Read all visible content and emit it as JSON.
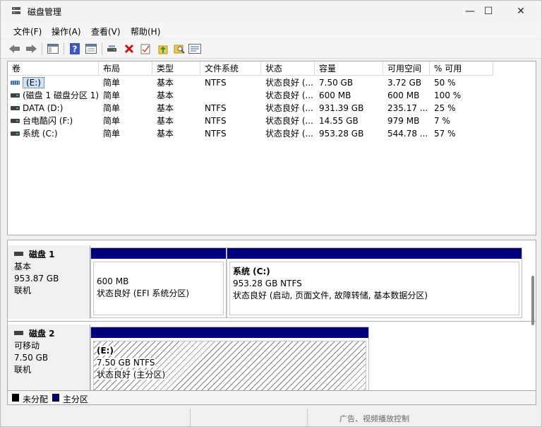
{
  "window": {
    "title": "磁盘管理",
    "minimize": "—",
    "maximize": "☐",
    "close": "✕"
  },
  "menu": [
    "文件(F)",
    "操作(A)",
    "查看(V)",
    "帮助(H)"
  ],
  "toolbar": {
    "icons": [
      "back-arrow-icon",
      "forward-arrow-icon",
      "console-tree-icon",
      "help-icon",
      "properties-list-icon",
      "connect-drive-icon",
      "delete-icon",
      "check-icon",
      "upload-folder-icon",
      "search-folder-icon",
      "settings-list-icon"
    ]
  },
  "volumes": {
    "headers": [
      "卷",
      "布局",
      "类型",
      "文件系统",
      "状态",
      "容量",
      "可用空间",
      "% 可用"
    ],
    "rows": [
      {
        "volume": "(E:)",
        "layout": "简单",
        "type": "基本",
        "fs": "NTFS",
        "status": "状态良好 (...",
        "capacity": "7.50 GB",
        "free": "3.72 GB",
        "pct": "50 %",
        "selected": true,
        "icon": "usb-drive-icon"
      },
      {
        "volume": "(磁盘 1 磁盘分区 1)",
        "layout": "简单",
        "type": "基本",
        "fs": "",
        "status": "状态良好 (...",
        "capacity": "600 MB",
        "free": "600 MB",
        "pct": "100 %",
        "selected": false,
        "icon": "drive-icon"
      },
      {
        "volume": "DATA (D:)",
        "layout": "简单",
        "type": "基本",
        "fs": "NTFS",
        "status": "状态良好 (...",
        "capacity": "931.39 GB",
        "free": "235.17 ...",
        "pct": "25 %",
        "selected": false,
        "icon": "drive-icon"
      },
      {
        "volume": "台电酷闪 (F:)",
        "layout": "简单",
        "type": "基本",
        "fs": "NTFS",
        "status": "状态良好 (...",
        "capacity": "14.55 GB",
        "free": "979 MB",
        "pct": "7 %",
        "selected": false,
        "icon": "drive-icon"
      },
      {
        "volume": "系统 (C:)",
        "layout": "简单",
        "type": "基本",
        "fs": "NTFS",
        "status": "状态良好 (...",
        "capacity": "953.28 GB",
        "free": "544.78 ...",
        "pct": "57 %",
        "selected": false,
        "icon": "drive-icon"
      }
    ]
  },
  "disks": [
    {
      "name": "磁盘 1",
      "kind": "基本",
      "size": "953.87 GB",
      "state": "联机",
      "partitions": [
        {
          "title": "",
          "size": "600 MB",
          "status": "状态良好 (EFI 系统分区)"
        },
        {
          "title": "系统 (C:)",
          "size": "953.28 GB NTFS",
          "status": "状态良好 (启动, 页面文件, 故障转储, 基本数据分区)"
        }
      ]
    },
    {
      "name": "磁盘 2",
      "kind": "可移动",
      "size": "7.50 GB",
      "state": "联机",
      "partitions": [
        {
          "title": "(E:)",
          "size": "7.50 GB NTFS",
          "status": "状态良好 (主分区)"
        }
      ]
    }
  ],
  "legend": [
    {
      "label": "未分配",
      "color": "#000000"
    },
    {
      "label": "主分区",
      "color": "#00007f"
    }
  ],
  "background_text": "广告、视频播放控制"
}
